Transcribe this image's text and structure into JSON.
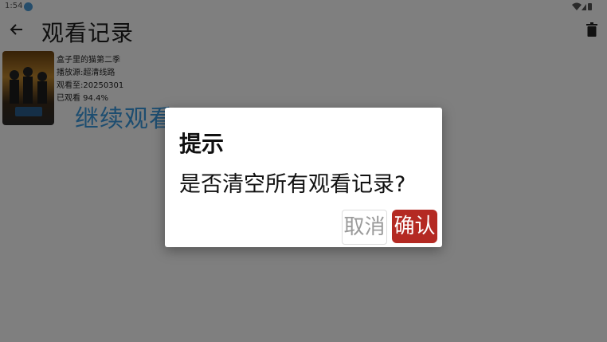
{
  "status_bar": {
    "time": "1:54",
    "icons": [
      "bluetooth-icon",
      "wifi-icon",
      "signal-icon",
      "battery-icon"
    ]
  },
  "app_bar": {
    "title": "观看记录",
    "back_icon": "back-arrow-icon",
    "action_icon": "trash-icon"
  },
  "history": [
    {
      "title": "盒子里的猫第二季",
      "source": "播放源:超清线路",
      "watched_until": "观看至:20250301",
      "progress": "已观看 94.4%",
      "continue_label": "继续观看"
    }
  ],
  "dialog": {
    "title": "提示",
    "message": "是否清空所有观看记录?",
    "cancel_label": "取消",
    "confirm_label": "确认"
  },
  "colors": {
    "confirm": "#b42a23",
    "continue": "#3a9be0",
    "scrim": "rgba(0,0,0,0.5)"
  }
}
